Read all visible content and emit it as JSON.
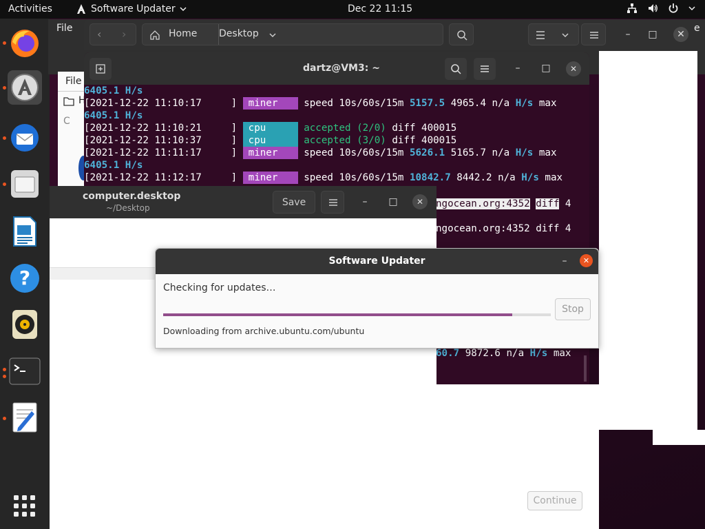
{
  "topbar": {
    "activities": "Activities",
    "app_name": "Software Updater",
    "clock": "Dec 22  11:15"
  },
  "files": {
    "menu_file": "File",
    "path_home": "Home",
    "path_desktop": "Desktop",
    "menu_file2": "File",
    "sidebar_h": "H",
    "sidebar_c": "C",
    "right_e": "e"
  },
  "terminal": {
    "title": "dartz@VM3: ~",
    "lines": [
      {
        "a": "6405.1 H/s",
        "k": "hs"
      },
      {
        "ts": "[2021-12-22 11:10:17",
        "tag": "miner",
        "rest": "speed 10s/60s/15m ",
        "v1": "5157.5",
        "v2": " 4965.4 n/a ",
        "unit": "H/s",
        "tail": " max"
      },
      {
        "a": "6405.1 H/s",
        "k": "hs"
      },
      {
        "ts": "[2021-12-22 11:10:21",
        "tag": "cpu",
        "acc": "accepted (2/0)",
        "rest": " diff 400015"
      },
      {
        "ts": "[2021-12-22 11:10:37",
        "tag": "cpu",
        "acc": "accepted (3/0)",
        "rest": " diff 400015"
      },
      {
        "ts": "[2021-12-22 11:11:17",
        "tag": "miner",
        "rest": "speed 10s/60s/15m ",
        "v1": "5626.1",
        "v2": " 5165.7 n/a ",
        "unit": "H/s",
        "tail": " max"
      },
      {
        "a": "6405.1 H/s",
        "k": "hs"
      },
      {
        "ts": "[2021-12-22 11:12:17",
        "tag": "miner",
        "rest": "speed 10s/60s/15m ",
        "v1": "10842.7",
        "v2": " 8442.2 n/a ",
        "unit": "H/s",
        "tail": " max"
      }
    ],
    "frag1_hl": "ngocean.org:4352",
    "frag1_hl2": "diff",
    "frag1_tail": " 4",
    "frag2": "ngocean.org:4352 diff 4",
    "frag3_v": "60.7",
    "frag3_rest": " 9872.6 n/a ",
    "frag3_unit": "H/s",
    "frag3_tail": " max"
  },
  "gedit": {
    "title": "computer.desktop",
    "subtitle": "~/Desktop",
    "save": "Save"
  },
  "dialog": {
    "title": "Software Updater",
    "status": "Checking for updates…",
    "stop": "Stop",
    "detail": "Downloading from archive.ubuntu.com/ubuntu",
    "progress": 0.9
  },
  "continue_label": "Continue",
  "colors": {
    "accent": "#e95420",
    "progress": "#924d8b"
  }
}
